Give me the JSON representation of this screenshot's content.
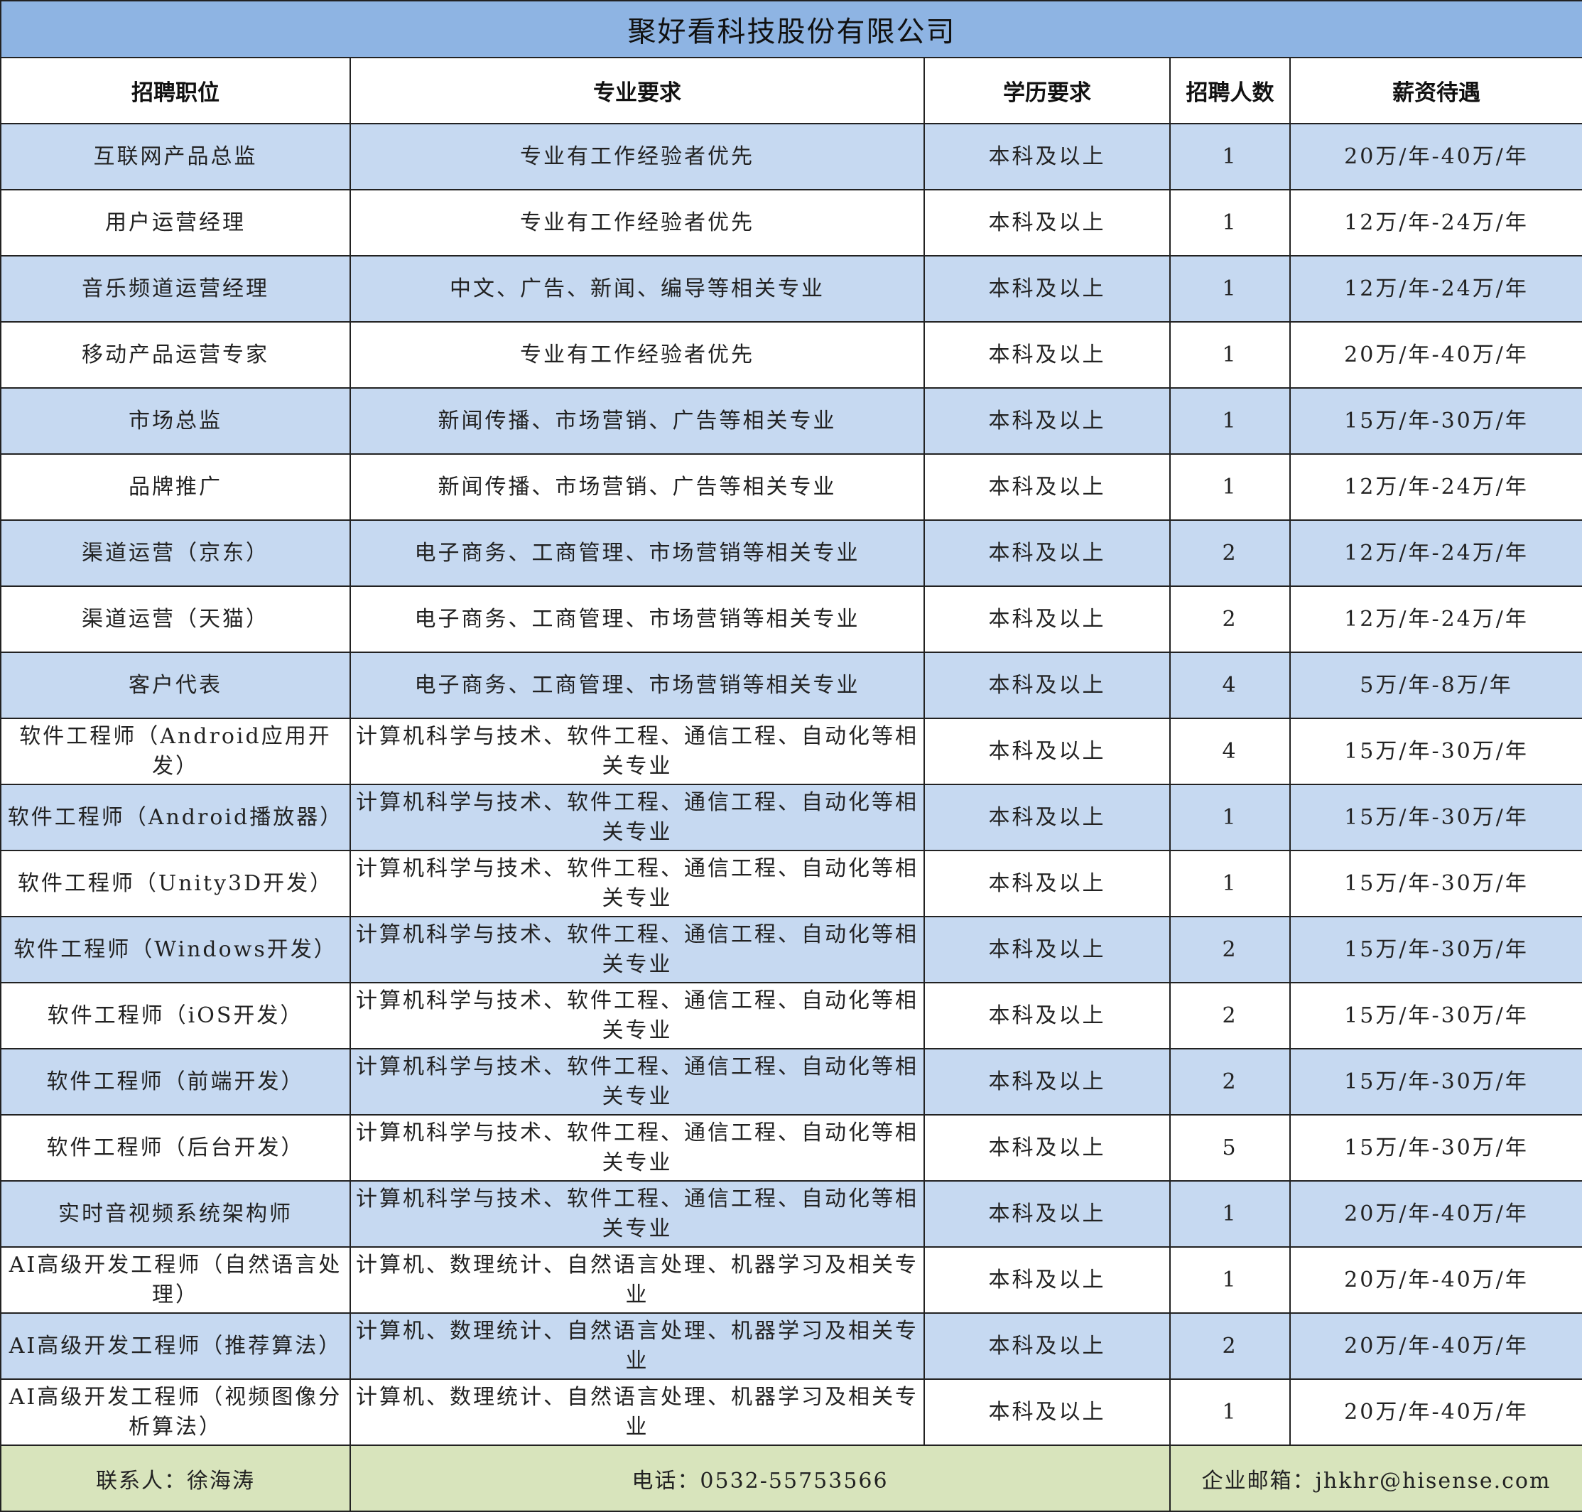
{
  "title": "聚好看科技股份有限公司",
  "headers": {
    "position": "招聘职位",
    "major": "专业要求",
    "education": "学历要求",
    "count": "招聘人数",
    "salary": "薪资待遇"
  },
  "rows": [
    {
      "position": "互联网产品总监",
      "major": "专业有工作经验者优先",
      "education": "本科及以上",
      "count": "1",
      "salary": "20万/年-40万/年"
    },
    {
      "position": "用户运营经理",
      "major": "专业有工作经验者优先",
      "education": "本科及以上",
      "count": "1",
      "salary": "12万/年-24万/年"
    },
    {
      "position": "音乐频道运营经理",
      "major": "中文、广告、新闻、编导等相关专业",
      "education": "本科及以上",
      "count": "1",
      "salary": "12万/年-24万/年"
    },
    {
      "position": "移动产品运营专家",
      "major": "专业有工作经验者优先",
      "education": "本科及以上",
      "count": "1",
      "salary": "20万/年-40万/年"
    },
    {
      "position": "市场总监",
      "major": "新闻传播、市场营销、广告等相关专业",
      "education": "本科及以上",
      "count": "1",
      "salary": "15万/年-30万/年"
    },
    {
      "position": "品牌推广",
      "major": "新闻传播、市场营销、广告等相关专业",
      "education": "本科及以上",
      "count": "1",
      "salary": "12万/年-24万/年"
    },
    {
      "position": "渠道运营（京东）",
      "major": "电子商务、工商管理、市场营销等相关专业",
      "education": "本科及以上",
      "count": "2",
      "salary": "12万/年-24万/年"
    },
    {
      "position": "渠道运营（天猫）",
      "major": "电子商务、工商管理、市场营销等相关专业",
      "education": "本科及以上",
      "count": "2",
      "salary": "12万/年-24万/年"
    },
    {
      "position": "客户代表",
      "major": "电子商务、工商管理、市场营销等相关专业",
      "education": "本科及以上",
      "count": "4",
      "salary": "5万/年-8万/年"
    },
    {
      "position": "软件工程师（Android应用开发）",
      "major": "计算机科学与技术、软件工程、通信工程、自动化等相关专业",
      "education": "本科及以上",
      "count": "4",
      "salary": "15万/年-30万/年"
    },
    {
      "position": "软件工程师（Android播放器）",
      "major": "计算机科学与技术、软件工程、通信工程、自动化等相关专业",
      "education": "本科及以上",
      "count": "1",
      "salary": "15万/年-30万/年"
    },
    {
      "position": "软件工程师（Unity3D开发）",
      "major": "计算机科学与技术、软件工程、通信工程、自动化等相关专业",
      "education": "本科及以上",
      "count": "1",
      "salary": "15万/年-30万/年"
    },
    {
      "position": "软件工程师（Windows开发）",
      "major": "计算机科学与技术、软件工程、通信工程、自动化等相关专业",
      "education": "本科及以上",
      "count": "2",
      "salary": "15万/年-30万/年"
    },
    {
      "position": "软件工程师（iOS开发）",
      "major": "计算机科学与技术、软件工程、通信工程、自动化等相关专业",
      "education": "本科及以上",
      "count": "2",
      "salary": "15万/年-30万/年"
    },
    {
      "position": "软件工程师（前端开发）",
      "major": "计算机科学与技术、软件工程、通信工程、自动化等相关专业",
      "education": "本科及以上",
      "count": "2",
      "salary": "15万/年-30万/年"
    },
    {
      "position": "软件工程师（后台开发）",
      "major": "计算机科学与技术、软件工程、通信工程、自动化等相关专业",
      "education": "本科及以上",
      "count": "5",
      "salary": "15万/年-30万/年"
    },
    {
      "position": "实时音视频系统架构师",
      "major": "计算机科学与技术、软件工程、通信工程、自动化等相关专业",
      "education": "本科及以上",
      "count": "1",
      "salary": "20万/年-40万/年"
    },
    {
      "position": "AI高级开发工程师（自然语言处理）",
      "major": "计算机、数理统计、自然语言处理、机器学习及相关专业",
      "education": "本科及以上",
      "count": "1",
      "salary": "20万/年-40万/年"
    },
    {
      "position": "AI高级开发工程师（推荐算法）",
      "major": "计算机、数理统计、自然语言处理、机器学习及相关专业",
      "education": "本科及以上",
      "count": "2",
      "salary": "20万/年-40万/年"
    },
    {
      "position": "AI高级开发工程师（视频图像分析算法）",
      "major": "计算机、数理统计、自然语言处理、机器学习及相关专业",
      "education": "本科及以上",
      "count": "1",
      "salary": "20万/年-40万/年"
    }
  ],
  "footer": {
    "contact": "联系人：徐海涛",
    "phone": "电话：0532-55753566",
    "email": "企业邮箱：jhkhr@hisense.com"
  },
  "colors": {
    "title_bg": "#8eb4e3",
    "shaded_row_bg": "#c6d9f1",
    "footer_bg": "#d8e4bc"
  }
}
